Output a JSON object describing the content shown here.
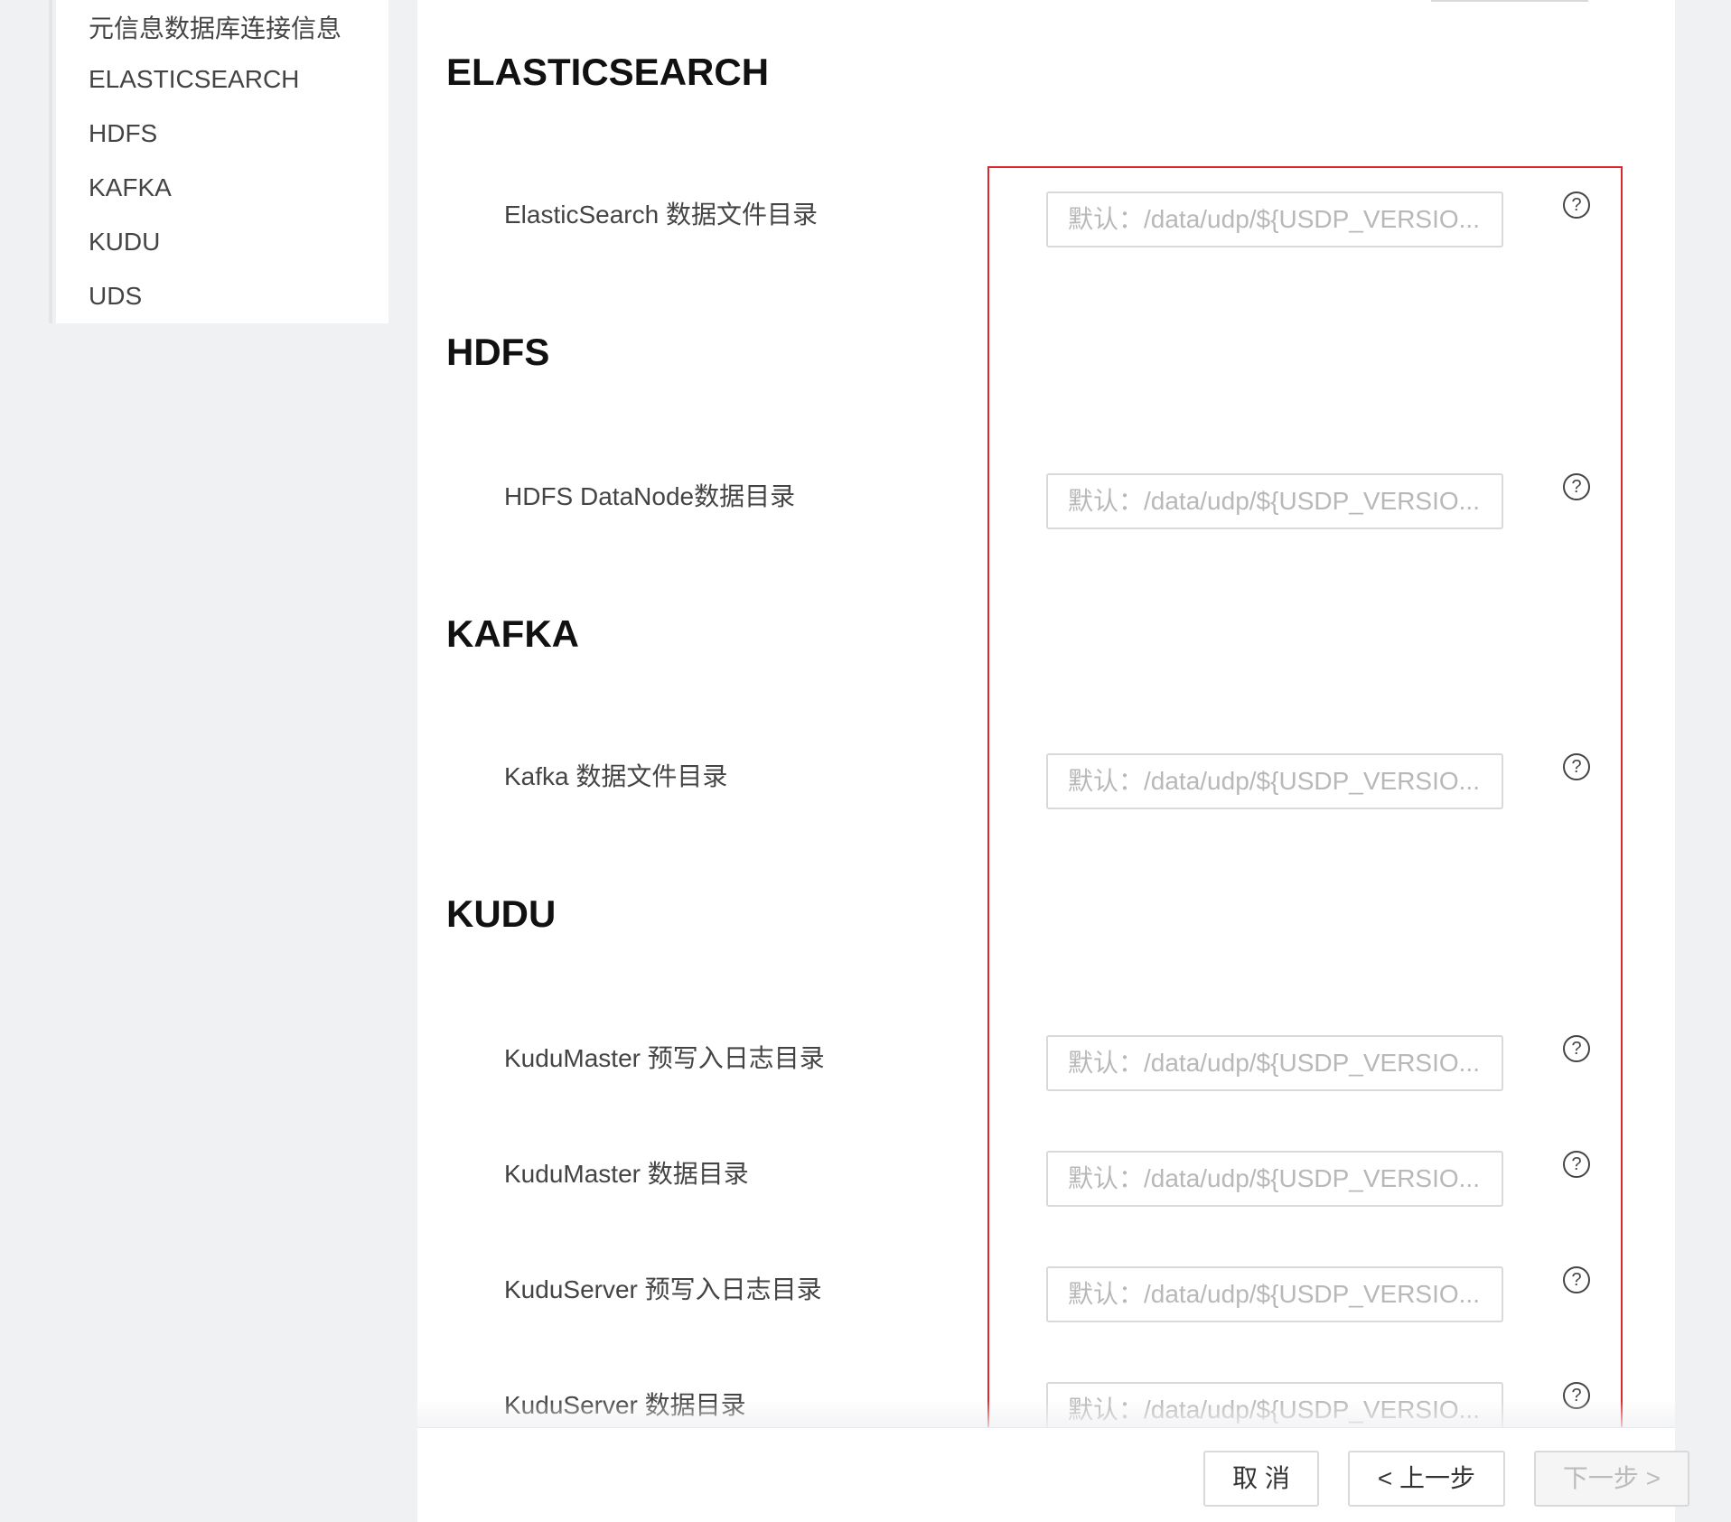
{
  "sidebar": {
    "items": [
      {
        "label": "元信息数据库连接信息"
      },
      {
        "label": "ELASTICSEARCH"
      },
      {
        "label": "HDFS"
      },
      {
        "label": "KAFKA"
      },
      {
        "label": "KUDU"
      },
      {
        "label": "UDS"
      }
    ]
  },
  "sections": [
    {
      "title": "ELASTICSEARCH",
      "fields": [
        {
          "label": "ElasticSearch 数据文件目录",
          "placeholder": "默认：/data/udp/${USDP_VERSIO...",
          "value": ""
        }
      ]
    },
    {
      "title": "HDFS",
      "fields": [
        {
          "label": "HDFS DataNode数据目录",
          "placeholder": "默认：/data/udp/${USDP_VERSIO...",
          "value": ""
        }
      ]
    },
    {
      "title": "KAFKA",
      "fields": [
        {
          "label": "Kafka 数据文件目录",
          "placeholder": "默认：/data/udp/${USDP_VERSIO...",
          "value": ""
        }
      ]
    },
    {
      "title": "KUDU",
      "fields": [
        {
          "label": "KuduMaster 预写入日志目录",
          "placeholder": "默认：/data/udp/${USDP_VERSIO...",
          "value": ""
        },
        {
          "label": "KuduMaster 数据目录",
          "placeholder": "默认：/data/udp/${USDP_VERSIO...",
          "value": ""
        },
        {
          "label": "KuduServer 预写入日志目录",
          "placeholder": "默认：/data/udp/${USDP_VERSIO...",
          "value": ""
        },
        {
          "label": "KuduServer 数据目录",
          "placeholder": "默认：/data/udp/${USDP_VERSIO...",
          "value": ""
        }
      ]
    }
  ],
  "help_glyph": "?",
  "footer": {
    "cancel_label": "取 消",
    "prev_label": "< 上一步",
    "next_label": "下一步 >"
  },
  "colors": {
    "highlight_border": "#e0262d",
    "placeholder": "#b8b8b8"
  }
}
